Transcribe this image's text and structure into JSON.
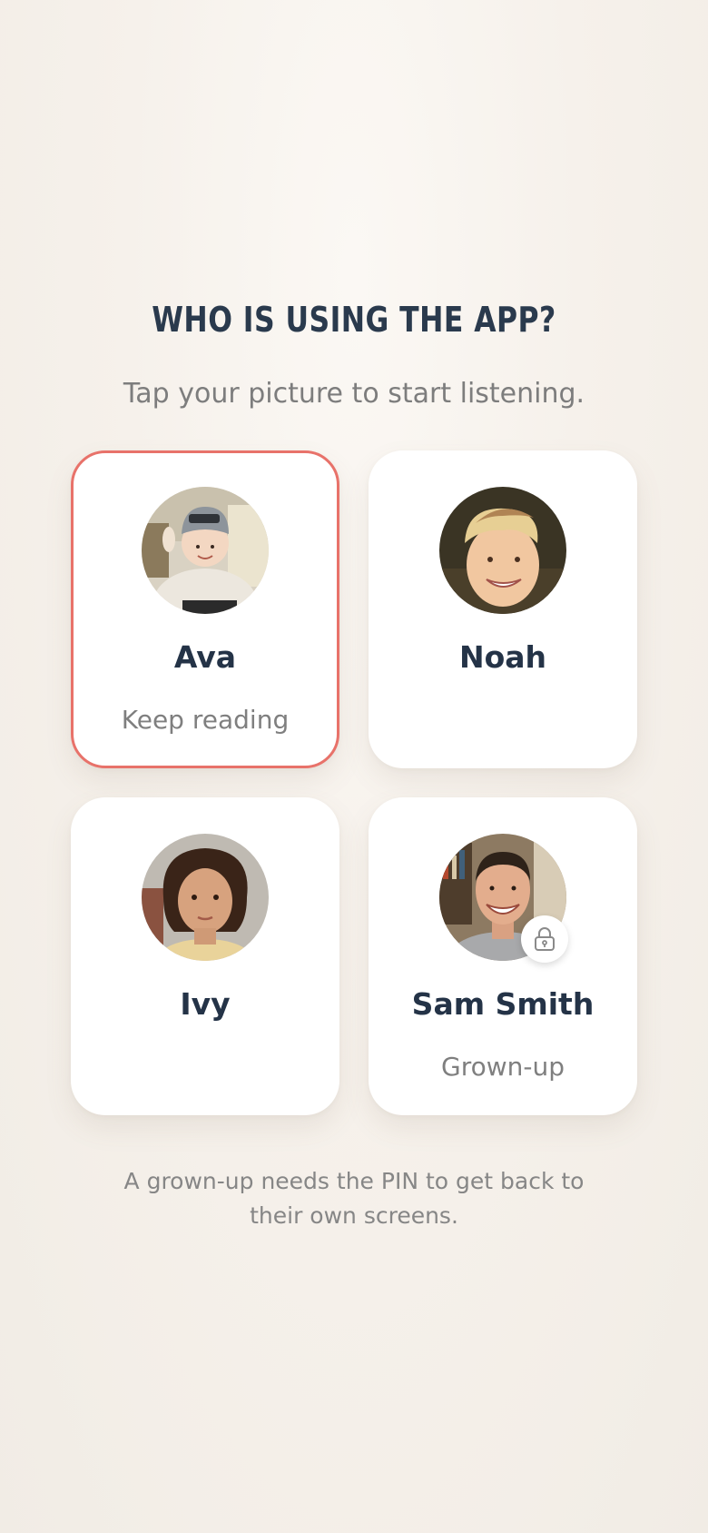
{
  "header": {
    "title": "Who is using the app?",
    "subtitle": "Tap your picture to start listening."
  },
  "profiles": [
    {
      "name": "Ava",
      "subtitle": "Keep reading",
      "selected": true,
      "locked": false,
      "avatar": "child-photo"
    },
    {
      "name": "Noah",
      "subtitle": "",
      "selected": false,
      "locked": false,
      "avatar": "child-photo"
    },
    {
      "name": "Ivy",
      "subtitle": "",
      "selected": false,
      "locked": false,
      "avatar": "child-photo"
    },
    {
      "name": "Sam Smith",
      "subtitle": "Grown-up",
      "selected": false,
      "locked": true,
      "avatar": "adult-photo"
    }
  ],
  "footer": {
    "note": "A grown-up needs the PIN to get back to their own screens."
  },
  "icons": {
    "lock": "lock-icon"
  },
  "colors": {
    "selected_border": "#e8726a",
    "title": "#2a3a4d",
    "name": "#243347"
  }
}
